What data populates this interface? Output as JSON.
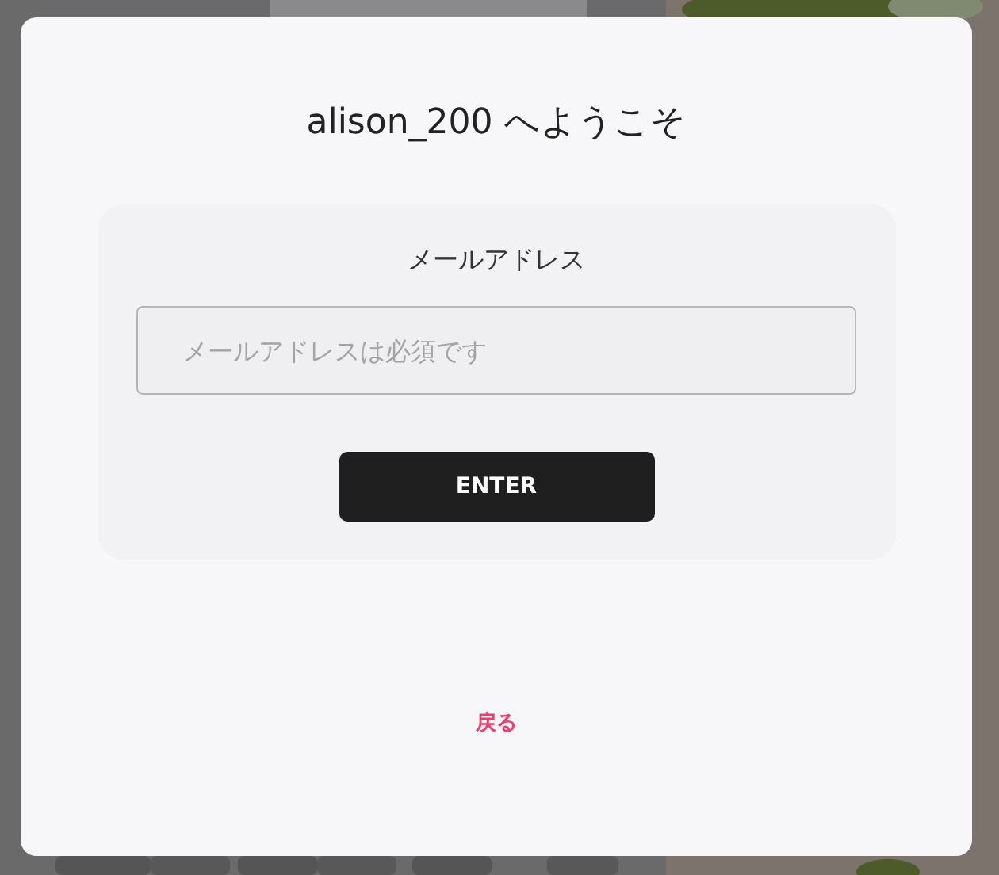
{
  "dialog": {
    "title": "alison_200 へようこそ",
    "email": {
      "label": "メールアドレス",
      "placeholder": "メールアドレスは必須です"
    },
    "submit": "ENTER",
    "back": "戻る"
  }
}
